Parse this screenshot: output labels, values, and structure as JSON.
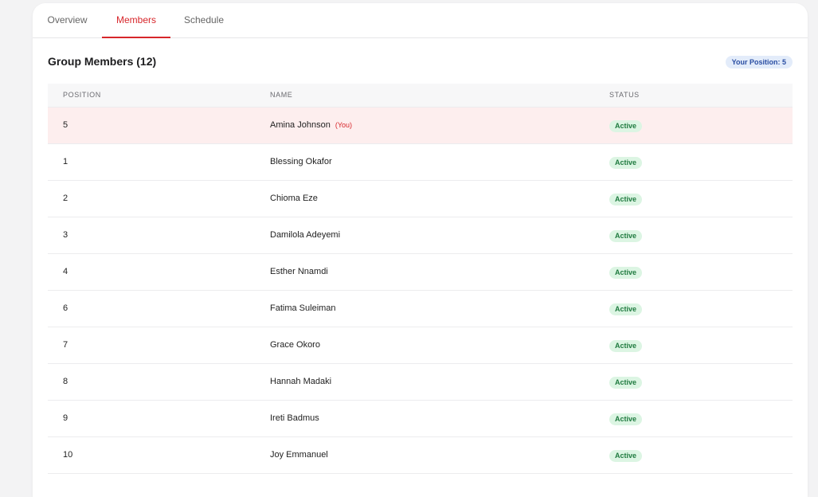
{
  "tabs": [
    {
      "label": "Overview"
    },
    {
      "label": "Members"
    },
    {
      "label": "Schedule"
    }
  ],
  "active_tab": "Members",
  "group": {
    "title": "Group Members (12)",
    "your_position_badge": "Your Position: 5"
  },
  "table": {
    "headers": {
      "position": "POSITION",
      "name": "NAME",
      "status": "STATUS"
    },
    "you_tag": "(You)",
    "rows": [
      {
        "position": "5",
        "name": "Amina Johnson",
        "status": "Active",
        "is_you": true
      },
      {
        "position": "1",
        "name": "Blessing Okafor",
        "status": "Active"
      },
      {
        "position": "2",
        "name": "Chioma Eze",
        "status": "Active"
      },
      {
        "position": "3",
        "name": "Damilola Adeyemi",
        "status": "Active"
      },
      {
        "position": "4",
        "name": "Esther Nnamdi",
        "status": "Active"
      },
      {
        "position": "6",
        "name": "Fatima Suleiman",
        "status": "Active"
      },
      {
        "position": "7",
        "name": "Grace Okoro",
        "status": "Active"
      },
      {
        "position": "8",
        "name": "Hannah Madaki",
        "status": "Active"
      },
      {
        "position": "9",
        "name": "Ireti Badmus",
        "status": "Active"
      },
      {
        "position": "10",
        "name": "Joy Emmanuel",
        "status": "Active"
      }
    ]
  },
  "colors": {
    "accent": "#d7262b",
    "you_row_bg": "#fdeeee",
    "status_bg": "#dcf5e3",
    "status_text": "#1f7a3f",
    "badge_bg": "#e3ecfa",
    "badge_text": "#2a4ea3"
  }
}
